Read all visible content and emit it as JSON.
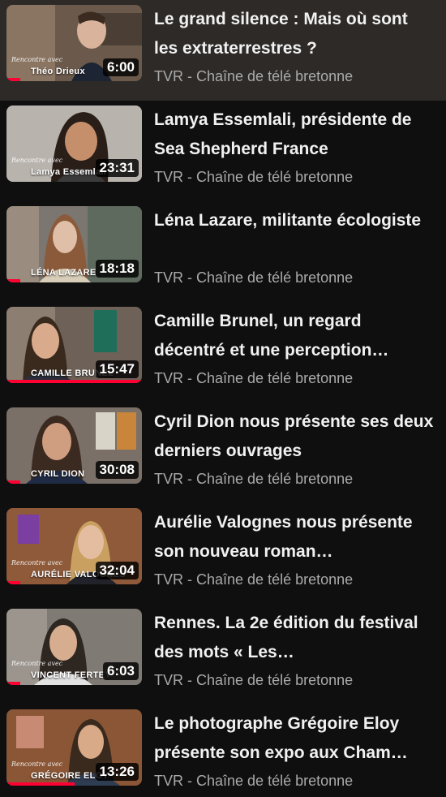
{
  "colors": {
    "background": "#0f0f0f",
    "active_background": "#2d2a27",
    "title": "#f1f1f1",
    "channel": "#aaaaaa",
    "progress": "#ff0033"
  },
  "playlist": {
    "items": [
      {
        "title": "Le grand silence : Mais où sont les extraterrestres ?",
        "channel": "TVR - Chaîne de télé bretonne",
        "duration": "6:00",
        "thumb_logo": "Rencontre avec",
        "thumb_name": "Théo Drieux",
        "watched": 0.1,
        "active": true
      },
      {
        "title": "Lamya Essemlali, présidente de Sea Shepherd France",
        "channel": "TVR - Chaîne de télé bretonne",
        "duration": "23:31",
        "thumb_logo": "Rencontre avec",
        "thumb_name": "Lamya Essemlali",
        "watched": 0.0,
        "active": false
      },
      {
        "title": "Léna Lazare, militante écologiste",
        "channel": "TVR - Chaîne de télé bretonne",
        "duration": "18:18",
        "thumb_logo": "",
        "thumb_name": "LÉNA LAZARE",
        "watched": 0.1,
        "active": false
      },
      {
        "title": "Camille Brunel, un regard décentré et une perception…",
        "channel": "TVR - Chaîne de télé bretonne",
        "duration": "15:47",
        "thumb_logo": "",
        "thumb_name": "CAMILLE BRUNEL",
        "watched": 1.0,
        "active": false
      },
      {
        "title": "Cyril Dion nous présente ses deux derniers ouvrages",
        "channel": "TVR - Chaîne de télé bretonne",
        "duration": "30:08",
        "thumb_logo": "",
        "thumb_name": "CYRIL DION",
        "watched": 0.1,
        "active": false
      },
      {
        "title": "Aurélie Valognes nous présente son nouveau roman…",
        "channel": "TVR - Chaîne de télé bretonne",
        "duration": "32:04",
        "thumb_logo": "Rencontre avec",
        "thumb_name": "AURÉLIE VALOGNES",
        "watched": 0.1,
        "active": false
      },
      {
        "title": "Rennes. La 2e édition du festival des mots « Les…",
        "channel": "TVR - Chaîne de télé bretonne",
        "duration": "6:03",
        "thumb_logo": "Rencontre avec",
        "thumb_name": "VINCENT FERTEY",
        "watched": 0.1,
        "active": false
      },
      {
        "title": "Le photographe Grégoire Eloy présente son expo aux Cham…",
        "channel": "TVR - Chaîne de télé bretonne",
        "duration": "13:26",
        "thumb_logo": "Rencontre avec",
        "thumb_name": "GRÉGOIRE ELOY",
        "watched": 0.5,
        "active": false
      }
    ]
  }
}
